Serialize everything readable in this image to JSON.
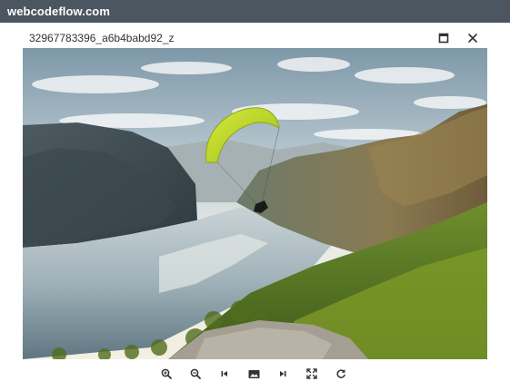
{
  "site": {
    "name": "webcodeflow.com"
  },
  "viewer": {
    "title": "32967783396_a6b4babd92_z",
    "header_buttons": [
      {
        "name": "maximize-icon"
      },
      {
        "name": "close-icon"
      }
    ],
    "image": {
      "subject": "paraglider-over-fjord-photo"
    },
    "toolbar": {
      "buttons": [
        {
          "name": "zoom-in-icon"
        },
        {
          "name": "zoom-out-icon"
        },
        {
          "name": "previous-icon"
        },
        {
          "name": "image-icon"
        },
        {
          "name": "next-icon"
        },
        {
          "name": "fullscreen-icon"
        },
        {
          "name": "rotate-icon"
        }
      ]
    }
  },
  "colors": {
    "topbar": "#4b5660",
    "icon": "#333333",
    "paraglider_wing": "#c8e02a"
  }
}
